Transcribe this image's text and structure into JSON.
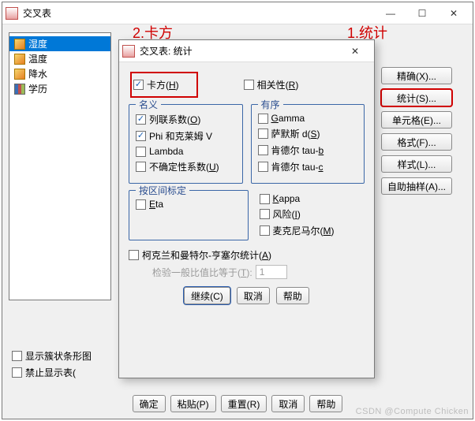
{
  "mainWindow": {
    "title": "交叉表",
    "listItems": [
      "湿度",
      "温度",
      "降水",
      "学历"
    ],
    "bottomChecks": {
      "clustered": "显示簇状条形图",
      "suppress": "禁止显示表("
    },
    "buttons": {
      "ok": "确定",
      "paste": "粘贴(P)",
      "reset": "重置(R)",
      "cancel": "取消",
      "help": "帮助"
    },
    "rightButtons": {
      "exact": "精确(X)...",
      "statistics": "统计(S)...",
      "cells": "单元格(E)...",
      "format": "格式(F)...",
      "style": "样式(L)...",
      "bootstrap": "自助抽样(A)..."
    }
  },
  "annotations": {
    "a1": "1.统计",
    "a2": "2.卡方"
  },
  "dialog": {
    "title": "交叉表: 统计",
    "top": {
      "chiSquare": {
        "label": "卡方(",
        "key": "H",
        "suffix": ")"
      },
      "correlations": {
        "label": "相关性(",
        "key": "R",
        "suffix": ")"
      }
    },
    "nominal": {
      "legend": "名义",
      "contingency": {
        "label": "列联系数(",
        "key": "O",
        "suffix": ")"
      },
      "phi": "Phi 和克莱姆 V",
      "lambda": "Lambda",
      "uncertainty": {
        "label": "不确定性系数(",
        "key": "U",
        "suffix": ")"
      }
    },
    "ordinal": {
      "legend": "有序",
      "gamma": {
        "label": "",
        "key": "G",
        "suffix": "amma"
      },
      "somers": {
        "label": "萨默斯 d(",
        "key": "S",
        "suffix": ")"
      },
      "taub": {
        "label": "肯德尔 tau-",
        "key": "b",
        "suffix": ""
      },
      "tauc": {
        "label": "肯德尔 tau-",
        "key": "c",
        "suffix": ""
      }
    },
    "interval": {
      "legend": "按区间标定",
      "eta": {
        "label": "",
        "key": "E",
        "suffix": "ta"
      }
    },
    "right2": {
      "kappa": {
        "label": "",
        "key": "K",
        "suffix": "appa"
      },
      "risk": {
        "label": "风险(",
        "key": "I",
        "suffix": ")"
      },
      "mcnemar": {
        "label": "麦克尼马尔(",
        "key": "M",
        "suffix": ")"
      }
    },
    "cmh": {
      "label": "柯克兰和曼特尔-亨塞尔统计(",
      "key": "A",
      "suffix": ")"
    },
    "cmhSub": {
      "label": "检验一般比值比等于(",
      "key": "T",
      "suffix": "):",
      "value": "1"
    },
    "buttons": {
      "continue": "继续(C)",
      "cancel": "取消",
      "help": "帮助"
    }
  },
  "watermark": "CSDN @Compute Chicken"
}
